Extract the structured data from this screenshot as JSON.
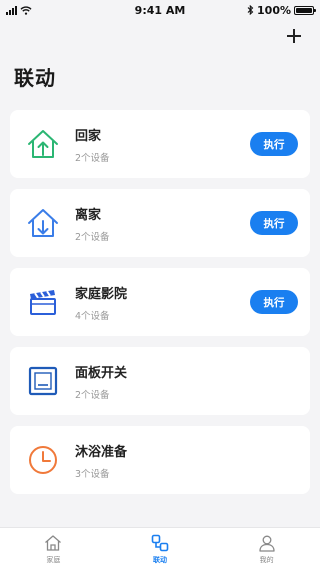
{
  "status_bar": {
    "time": "9:41 AM",
    "battery_text": "100%",
    "icons": [
      "signal-icon",
      "wifi-icon",
      "bluetooth-icon",
      "battery-icon"
    ]
  },
  "header": {
    "title": "联动",
    "add_icon": "plus-icon"
  },
  "colors": {
    "accent": "#1a7ff0",
    "home_icon": "#2bb673",
    "leave_icon": "#3a7de8",
    "theater_icon": "#2b5fd9",
    "panel_icon": "#1f5bb8",
    "bath_icon": "#f0793a"
  },
  "scenes": [
    {
      "title": "回家",
      "subtitle": "2个设备",
      "icon": "home-arrive-icon",
      "action_label": "执行"
    },
    {
      "title": "离家",
      "subtitle": "2个设备",
      "icon": "home-leave-icon",
      "action_label": "执行"
    },
    {
      "title": "家庭影院",
      "subtitle": "4个设备",
      "icon": "clapperboard-icon",
      "action_label": "执行"
    },
    {
      "title": "面板开关",
      "subtitle": "2个设备",
      "icon": "panel-switch-icon"
    },
    {
      "title": "沐浴准备",
      "subtitle": "3个设备",
      "icon": "clock-icon"
    }
  ],
  "tabs": [
    {
      "label": "家庭",
      "icon": "home-icon",
      "active": false
    },
    {
      "label": "联动",
      "icon": "link-icon",
      "active": true
    },
    {
      "label": "我的",
      "icon": "user-icon",
      "active": false
    }
  ]
}
